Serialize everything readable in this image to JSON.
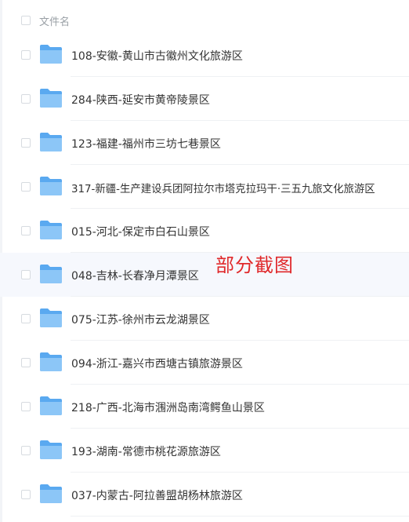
{
  "header": {
    "column_label": "文件名"
  },
  "files": [
    {
      "name": "108-安徽-黄山市古徽州文化旅游区",
      "icon": "folder-icon"
    },
    {
      "name": "284-陕西-延安市黄帝陵景区",
      "icon": "folder-icon"
    },
    {
      "name": "123-福建-福州市三坊七巷景区",
      "icon": "folder-icon"
    },
    {
      "name": "317-新疆-生产建设兵团阿拉尔市塔克拉玛干·三五九旅文化旅游区",
      "icon": "folder-icon"
    },
    {
      "name": "015-河北-保定市白石山景区",
      "icon": "folder-icon"
    },
    {
      "name": "048-吉林-长春净月潭景区",
      "icon": "folder-icon"
    },
    {
      "name": "075-江苏-徐州市云龙湖景区",
      "icon": "folder-icon"
    },
    {
      "name": "094-浙江-嘉兴市西塘古镇旅游景区",
      "icon": "folder-icon"
    },
    {
      "name": "218-广西-北海市涠洲岛南湾鳄鱼山景区",
      "icon": "folder-icon"
    },
    {
      "name": "193-湖南-常德市桃花源旅游区",
      "icon": "folder-icon"
    },
    {
      "name": "037-内蒙古-阿拉善盟胡杨林旅游区",
      "icon": "folder-icon"
    }
  ],
  "watermark": "部分截图",
  "colors": {
    "folder": "#5aa9f0",
    "folder_light": "#8cc6f7",
    "watermark": "#e0292b",
    "hover_row": "#f6f8fd"
  }
}
